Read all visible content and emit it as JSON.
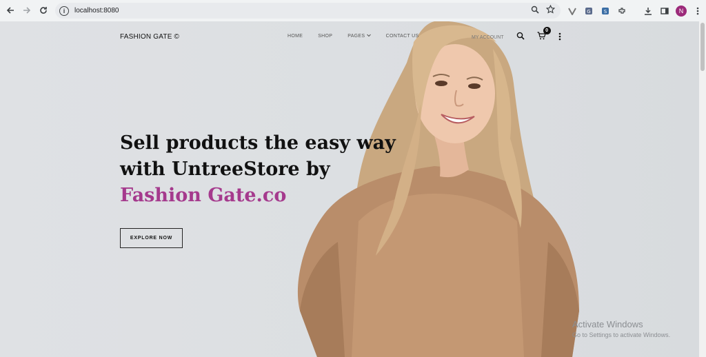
{
  "browser": {
    "url": "localhost:8080",
    "profile_initial": "N",
    "icons": [
      "back-icon",
      "forward-icon",
      "reload-icon",
      "site-info-icon",
      "zoom-icon",
      "bookmark-star-icon",
      "extension-icon",
      "downloads-icon",
      "side-panel-icon",
      "menu-icon"
    ]
  },
  "site": {
    "brand": "FASHION GATE ©",
    "menu": [
      "HOME",
      "SHOP",
      "PAGES",
      "CONTACT US"
    ],
    "account_label": "MY ACCOUNT",
    "cart_count": "0"
  },
  "hero": {
    "line1": "Sell products the easy way",
    "line2": "with UntreeStore by",
    "accent": "Fashion Gate.co",
    "button": "EXPLORE NOW"
  },
  "watermark": {
    "title": "Activate Windows",
    "subtitle": "Go to Settings to activate Windows."
  },
  "colors": {
    "accent": "#a53a8d",
    "background": "#dcdfe2"
  }
}
